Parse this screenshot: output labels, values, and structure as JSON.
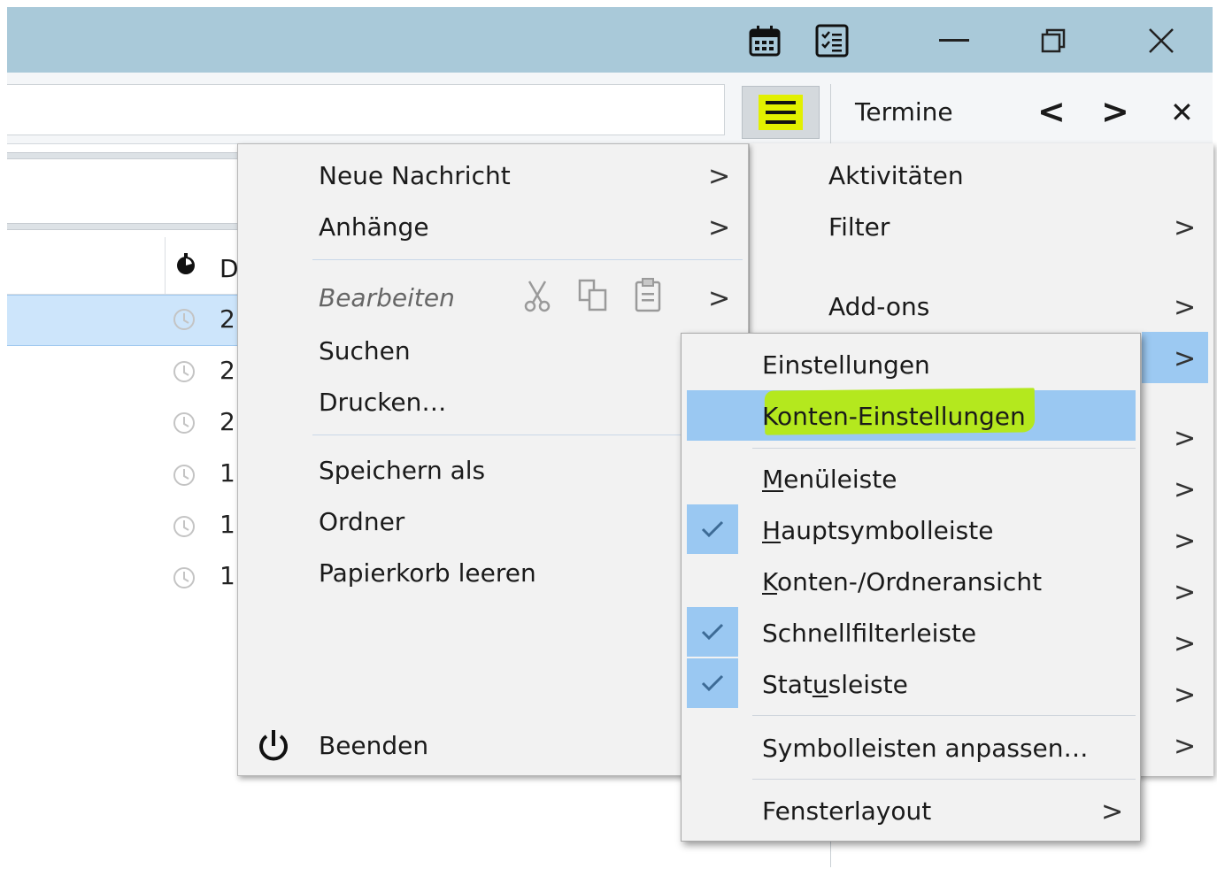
{
  "toolbar": {
    "panel_title": "Termine",
    "prev": "<",
    "next": ">",
    "close": "✕"
  },
  "message_list": {
    "header_date_fragment": "D",
    "row_dates": [
      "2",
      "2",
      "2",
      "1",
      "1",
      "1"
    ]
  },
  "main_menu": {
    "items": {
      "new_message": "Neue Nachricht",
      "attachments": "Anhänge",
      "edit": "Bearbeiten",
      "search": "Suchen",
      "print": "Drucken…",
      "save_as": "Speichern als",
      "folder": "Ordner",
      "empty_trash": "Papierkorb leeren",
      "quit": "Beenden"
    },
    "chevron": ">"
  },
  "right_menu": {
    "items": {
      "activities": "Aktivitäten",
      "filter": "Filter",
      "addons": "Add-ons"
    },
    "chevron": ">"
  },
  "submenu": {
    "settings": "Einstellungen",
    "account_settings": "Konten-Einstellungen",
    "menubar": {
      "u": "M",
      "rest": "enüleiste"
    },
    "main_toolbar": {
      "u": "H",
      "rest": "auptsymbolleiste"
    },
    "folder_pane": {
      "u": "K",
      "rest": "onten-/Ordneransicht"
    },
    "quick_filter": "Schnellfilterleiste",
    "status_bar": {
      "pre": "Stat",
      "u": "u",
      "rest": "sleiste"
    },
    "customize": "Symbolleisten anpassen…",
    "layout": "Fensterlayout",
    "chevron": ">",
    "checked": {
      "main_toolbar": true,
      "quick_filter": true,
      "status_bar": true,
      "menubar": false,
      "folder_pane": false
    }
  },
  "colors": {
    "titlebar": "#a9c9d9",
    "highlight_blue": "#9ac8f2",
    "marker_green": "#b4e81e",
    "button_yellow": "#e2f000"
  }
}
